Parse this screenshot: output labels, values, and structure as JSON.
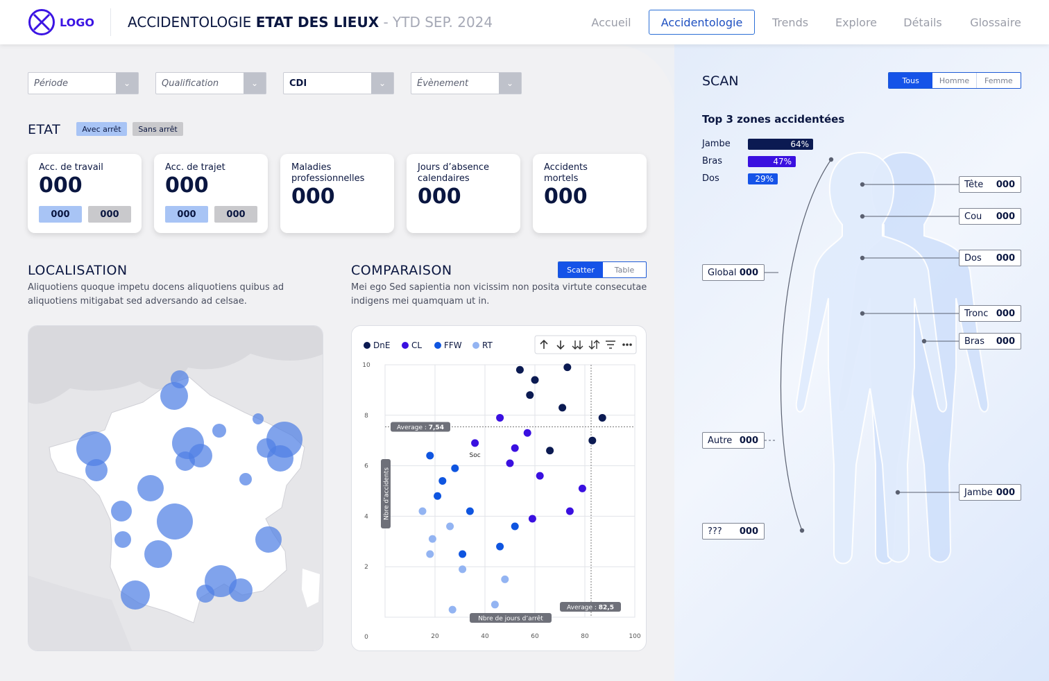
{
  "header": {
    "logo_text": "LOGO",
    "title_part1": "ACCIDENTOLOGIE ",
    "title_bold": "ETAT DES LIEUX",
    "title_suffix": " - YTD SEP. 2024",
    "nav": [
      "Accueil",
      "Accidentologie",
      "Trends",
      "Explore",
      "Détails",
      "Glossaire"
    ],
    "active_nav": "Accidentologie"
  },
  "filters": {
    "periode": "Période",
    "qualification": "Qualification",
    "contrat": "CDI",
    "evenement": "Évènement"
  },
  "etat": {
    "title": "ETAT",
    "chip_avec": "Avec arrêt",
    "chip_sans": "Sans arrêt",
    "cards": [
      {
        "label": "Acc. de travail",
        "value": "000",
        "avec": "000",
        "sans": "000"
      },
      {
        "label": "Acc. de trajet",
        "value": "000",
        "avec": "000",
        "sans": "000"
      },
      {
        "label": "Maladies professionnelles",
        "value": "000"
      },
      {
        "label": "Jours d’absence calendaires",
        "value": "000"
      },
      {
        "label": "Accidents mortels",
        "value": "000"
      }
    ]
  },
  "localisation": {
    "title": "LOCALISATION",
    "description": "Aliquotiens quoque impetu docens aliquotiens quibus ad aliquotiens mitigabat sed adversando ad celsae."
  },
  "comparaison": {
    "title": "COMPARAISON",
    "toggle": [
      "Scatter",
      "Table"
    ],
    "toggle_active": "Scatter",
    "description": "Mei ego Sed sapientia non vicissim non posita virtute consecutae indigens mei quamquam ut in."
  },
  "chart_data": {
    "type": "scatter",
    "xlabel": "Nbre de jours d’arrêt",
    "ylabel": "Nbre d’accidents",
    "xlim": [
      0,
      100
    ],
    "ylim": [
      0,
      10
    ],
    "xticks": [
      20,
      40,
      60,
      80,
      100
    ],
    "yticks": [
      0,
      2,
      4,
      6,
      8,
      10
    ],
    "grid": true,
    "legend_position": "top-left",
    "avg_y": {
      "label": "Average : ",
      "value": "7,54",
      "y": 7.54
    },
    "avg_x": {
      "label": "Average : ",
      "value": "82,5",
      "x": 82.5
    },
    "annotation": {
      "text": "Soc",
      "x": 36,
      "y": 6.9
    },
    "series": [
      {
        "name": "DnE",
        "color": "#0b1a52",
        "points": [
          [
            54,
            9.8
          ],
          [
            60,
            9.4
          ],
          [
            58,
            8.8
          ],
          [
            71,
            8.3
          ],
          [
            73,
            9.9
          ],
          [
            87,
            7.9
          ],
          [
            83,
            7.0
          ],
          [
            66,
            6.6
          ]
        ]
      },
      {
        "name": "CL",
        "color": "#3a10e0",
        "points": [
          [
            46,
            7.9
          ],
          [
            57,
            7.3
          ],
          [
            36,
            6.9
          ],
          [
            52,
            6.7
          ],
          [
            50,
            6.1
          ],
          [
            62,
            5.6
          ],
          [
            79,
            5.1
          ],
          [
            74,
            4.2
          ],
          [
            59,
            3.9
          ]
        ]
      },
      {
        "name": "FFW",
        "color": "#0f55e0",
        "points": [
          [
            18,
            6.4
          ],
          [
            28,
            5.9
          ],
          [
            23,
            5.4
          ],
          [
            21,
            4.8
          ],
          [
            34,
            4.2
          ],
          [
            52,
            3.6
          ],
          [
            31,
            2.5
          ],
          [
            46,
            2.8
          ]
        ]
      },
      {
        "name": "RT",
        "color": "#93b4f2",
        "points": [
          [
            15,
            4.2
          ],
          [
            19,
            3.1
          ],
          [
            26,
            3.6
          ],
          [
            18,
            2.5
          ],
          [
            31,
            1.9
          ],
          [
            48,
            1.5
          ],
          [
            44,
            0.5
          ],
          [
            27,
            0.3
          ]
        ]
      }
    ]
  },
  "scan": {
    "title": "SCAN",
    "toggle": [
      "Tous",
      "Homme",
      "Femme"
    ],
    "toggle_active": "Tous",
    "top3_title": "Top 3 zones accidentées",
    "top3": [
      {
        "label": "Jambe",
        "value": "64%",
        "pct": 64,
        "color": "#0b1a52"
      },
      {
        "label": "Bras",
        "value": "47%",
        "pct": 47,
        "color": "#3a10e0"
      },
      {
        "label": "Dos",
        "value": "29%",
        "pct": 29,
        "color": "#1553e8"
      }
    ],
    "zones": {
      "tete": {
        "label": "Tête",
        "value": "000"
      },
      "cou": {
        "label": "Cou",
        "value": "000"
      },
      "dos": {
        "label": "Dos",
        "value": "000"
      },
      "tronc": {
        "label": "Tronc",
        "value": "000"
      },
      "bras": {
        "label": "Bras",
        "value": "000"
      },
      "jambe": {
        "label": "Jambe",
        "value": "000"
      },
      "global": {
        "label": "Global",
        "value": "000"
      },
      "autre": {
        "label": "Autre",
        "value": "000"
      },
      "inconnu": {
        "label": "???",
        "value": "000"
      }
    }
  },
  "colors": {
    "accent": "#1553e8",
    "brand": "#3b14e3",
    "navy": "#0a1640",
    "avec_chip": "#a8c4f5",
    "sans_chip": "#c9c9cc"
  }
}
